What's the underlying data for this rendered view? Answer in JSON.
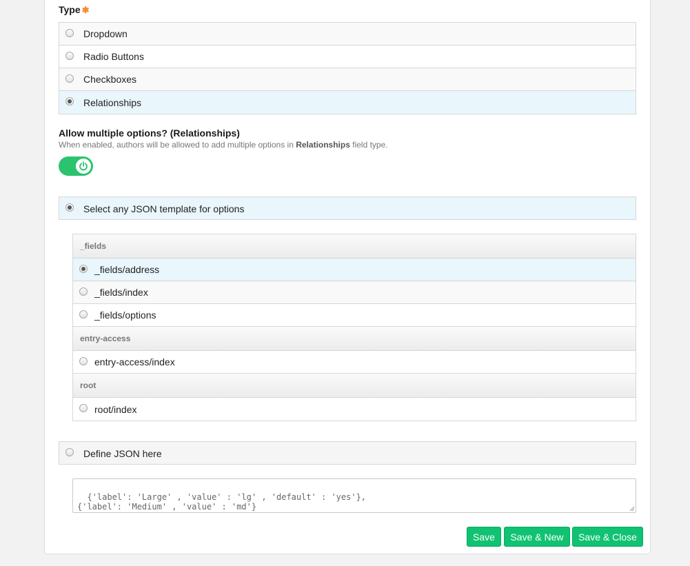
{
  "type_section": {
    "label": "Type",
    "required_mark": "✱",
    "options": [
      {
        "label": "Dropdown",
        "checked": false
      },
      {
        "label": "Radio Buttons",
        "checked": false
      },
      {
        "label": "Checkboxes",
        "checked": false
      },
      {
        "label": "Relationships",
        "checked": true
      }
    ]
  },
  "allow_multiple": {
    "title": "Allow multiple options? (Relationships)",
    "desc_prefix": "When enabled, authors will be allowed to add multiple options in ",
    "desc_bold": "Relationships",
    "desc_suffix": " field type.",
    "enabled": true,
    "toggle_icon": "power-icon"
  },
  "json_source": {
    "select_label": "Select any JSON template for options",
    "select_checked": true,
    "define_label": "Define JSON here",
    "define_checked": false
  },
  "templates": {
    "groups": [
      {
        "name": "_fields",
        "items": [
          {
            "label": "_fields/address",
            "checked": true
          },
          {
            "label": "_fields/index",
            "checked": false
          },
          {
            "label": "_fields/options",
            "checked": false
          }
        ]
      },
      {
        "name": "entry-access",
        "items": [
          {
            "label": "entry-access/index",
            "checked": false
          }
        ]
      },
      {
        "name": "root",
        "items": [
          {
            "label": "root/index",
            "checked": false
          }
        ]
      }
    ]
  },
  "json_textarea": {
    "value": "{'label': 'Large' , 'value' : 'lg' , 'default' : 'yes'},\n{'label': 'Medium' , 'value' : 'md'}"
  },
  "buttons": {
    "save": "Save",
    "save_new": "Save & New",
    "save_close": "Save & Close"
  },
  "colors": {
    "accent_green": "#10c271",
    "selected_row": "#e9f6fc",
    "required": "#f28a2e"
  }
}
